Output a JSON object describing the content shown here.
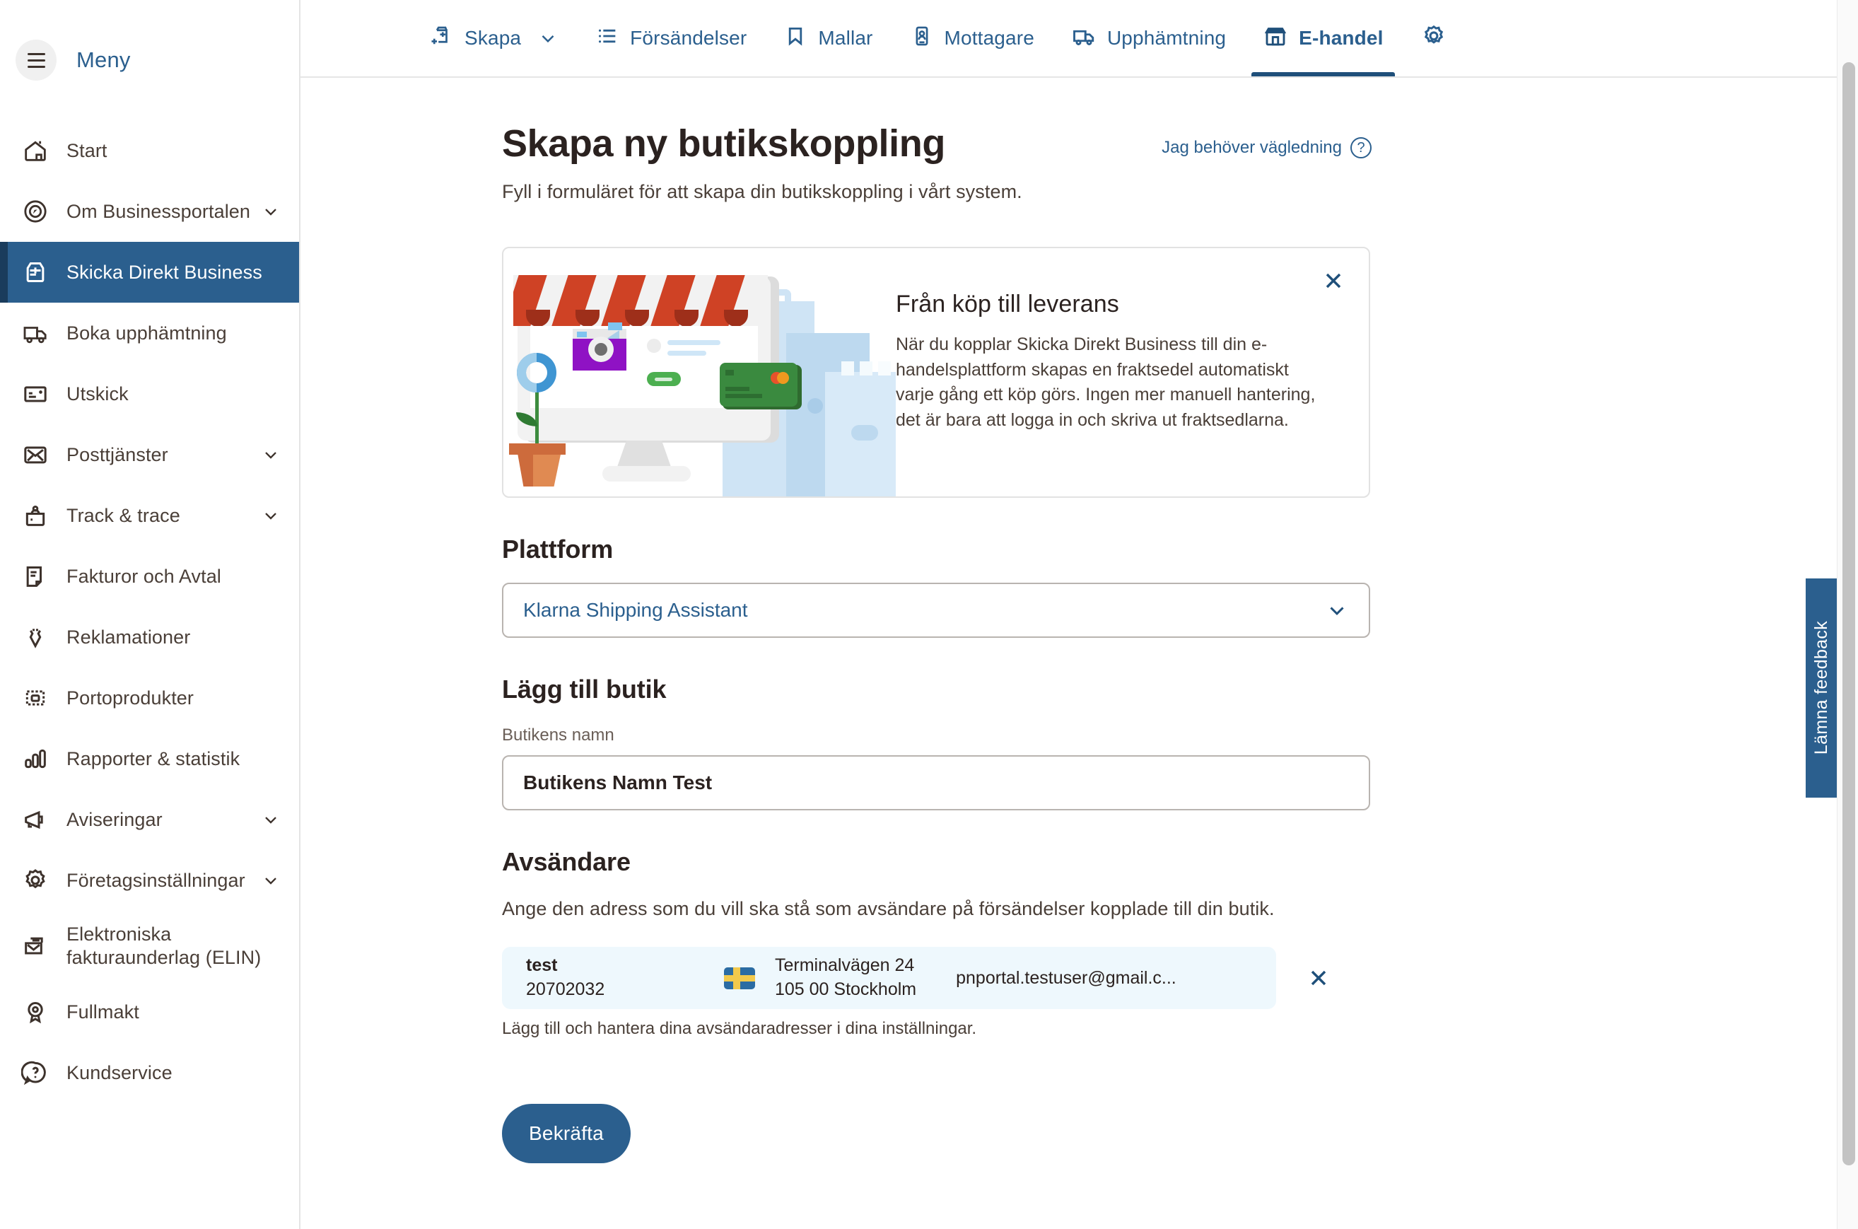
{
  "sidebar": {
    "menu_label": "Meny",
    "menu_icon": "hamburger-icon",
    "items": [
      {
        "label": "Start",
        "icon": "home-icon",
        "active": false,
        "chevron": false
      },
      {
        "label": "Om Businessportalen",
        "icon": "compass-icon",
        "active": false,
        "chevron": true
      },
      {
        "label": "Skicka Direkt Business",
        "icon": "parcel-icon",
        "active": true,
        "chevron": false
      },
      {
        "label": "Boka upphämtning",
        "icon": "truck-icon",
        "active": false,
        "chevron": false
      },
      {
        "label": "Utskick",
        "icon": "envelope-card-icon",
        "active": false,
        "chevron": false
      },
      {
        "label": "Posttjänster",
        "icon": "mail-icon",
        "active": false,
        "chevron": true
      },
      {
        "label": "Track & trace",
        "icon": "package-pin-icon",
        "active": false,
        "chevron": true
      },
      {
        "label": "Fakturor och Avtal",
        "icon": "document-icon",
        "active": false,
        "chevron": false
      },
      {
        "label": "Reklamationer",
        "icon": "damaged-parcel-icon",
        "active": false,
        "chevron": false
      },
      {
        "label": "Portoprodukter",
        "icon": "stamp-icon",
        "active": false,
        "chevron": false
      },
      {
        "label": "Rapporter & statistik",
        "icon": "bar-chart-icon",
        "active": false,
        "chevron": false
      },
      {
        "label": "Aviseringar",
        "icon": "megaphone-icon",
        "active": false,
        "chevron": true
      },
      {
        "label": "Företagsinställningar",
        "icon": "gear-icon",
        "active": false,
        "chevron": true
      },
      {
        "label": "Elektroniska fakturaunderlag (ELIN)",
        "icon": "e-invoice-icon",
        "active": false,
        "chevron": false
      },
      {
        "label": "Fullmakt",
        "icon": "badge-icon",
        "active": false,
        "chevron": false
      },
      {
        "label": "Kundservice",
        "icon": "question-chat-icon",
        "active": false,
        "chevron": false
      }
    ]
  },
  "topnav": {
    "items": [
      {
        "label": "Skapa",
        "icon": "add-parcel-icon",
        "chevron": true,
        "active": false
      },
      {
        "label": "Försändelser",
        "icon": "list-icon",
        "chevron": false,
        "active": false
      },
      {
        "label": "Mallar",
        "icon": "bookmark-icon",
        "chevron": false,
        "active": false
      },
      {
        "label": "Mottagare",
        "icon": "recipient-icon",
        "chevron": false,
        "active": false
      },
      {
        "label": "Upphämtning",
        "icon": "truck-icon",
        "chevron": false,
        "active": false
      },
      {
        "label": "E-handel",
        "icon": "shop-icon",
        "chevron": false,
        "active": true
      },
      {
        "label": "",
        "icon": "gear-icon",
        "chevron": false,
        "active": false
      }
    ]
  },
  "page": {
    "title": "Skapa ny butikskoppling",
    "subtitle": "Fyll i formuläret för att skapa din butikskoppling i vårt system.",
    "guidance_link": "Jag behöver vägledning",
    "guidance_icon": "question-mark-icon"
  },
  "info_card": {
    "heading": "Från köp till leverans",
    "body": "När du kopplar Skicka Direkt Business till din e-handelsplattform skapas en fraktsedel automatiskt varje gång ett köp görs. Ingen mer manuell hantering, det är bara att logga in och skriva ut fraktsedlarna.",
    "close_icon": "close-icon",
    "illustration": "online-shop-illustration"
  },
  "form": {
    "platform_heading": "Plattform",
    "platform_value": "Klarna Shipping Assistant",
    "platform_chevron_icon": "chevron-down-icon",
    "store_heading": "Lägg till butik",
    "store_field_label": "Butikens namn",
    "store_field_value": "Butikens Namn Test",
    "store_field_placeholder": "Butikens namn",
    "sender_heading": "Avsändare",
    "sender_description": "Ange den adress som du vill ska stå som avsändare på försändelser kopplade till din butik.",
    "sender": {
      "name": "test",
      "customer_number": "20702032",
      "flag_icon": "sweden-flag-icon",
      "street": "Terminalvägen 24",
      "postal_city": "105 00 Stockholm",
      "email": "pnportal.testuser@gmail.c...",
      "remove_icon": "close-icon"
    },
    "sender_helper": "Lägg till och hantera dina avsändaradresser i dina inställningar.",
    "confirm_label": "Bekräfta"
  },
  "feedback": {
    "label": "Lämna feedback"
  },
  "colors": {
    "brand_blue": "#2b5f8e",
    "brand_blue_dark": "#1a3c5c",
    "text_brown": "#4a3f38",
    "heading": "#2b2220",
    "card_bg": "#eef8fd"
  }
}
